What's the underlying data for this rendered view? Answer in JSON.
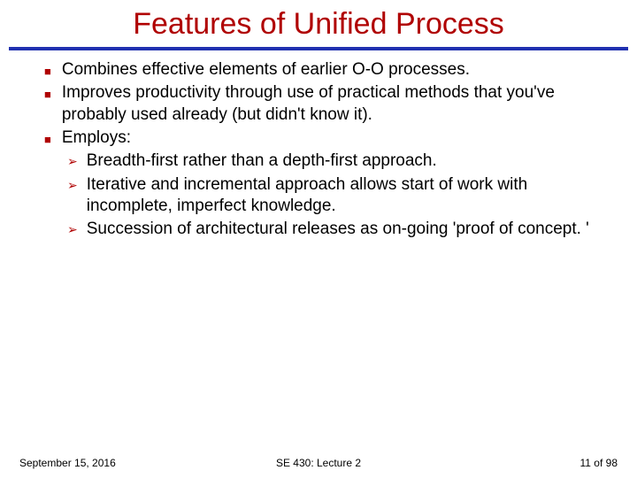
{
  "title": "Features of Unified Process",
  "bullets": [
    {
      "text": "Combines effective elements of earlier O-O processes."
    },
    {
      "text": "Improves productivity through use of practical methods that you've probably used already (but didn't know it)."
    },
    {
      "text": "Employs:"
    }
  ],
  "subbullets": [
    {
      "text": "Breadth-first rather than a depth-first approach."
    },
    {
      "text": "Iterative and incremental approach allows start of work with incomplete, imperfect knowledge."
    },
    {
      "text": "Succession of architectural releases as on-going 'proof of concept. '"
    }
  ],
  "footer": {
    "date": "September 15, 2016",
    "course": "SE 430: Lecture 2",
    "page": "11 of 98"
  }
}
